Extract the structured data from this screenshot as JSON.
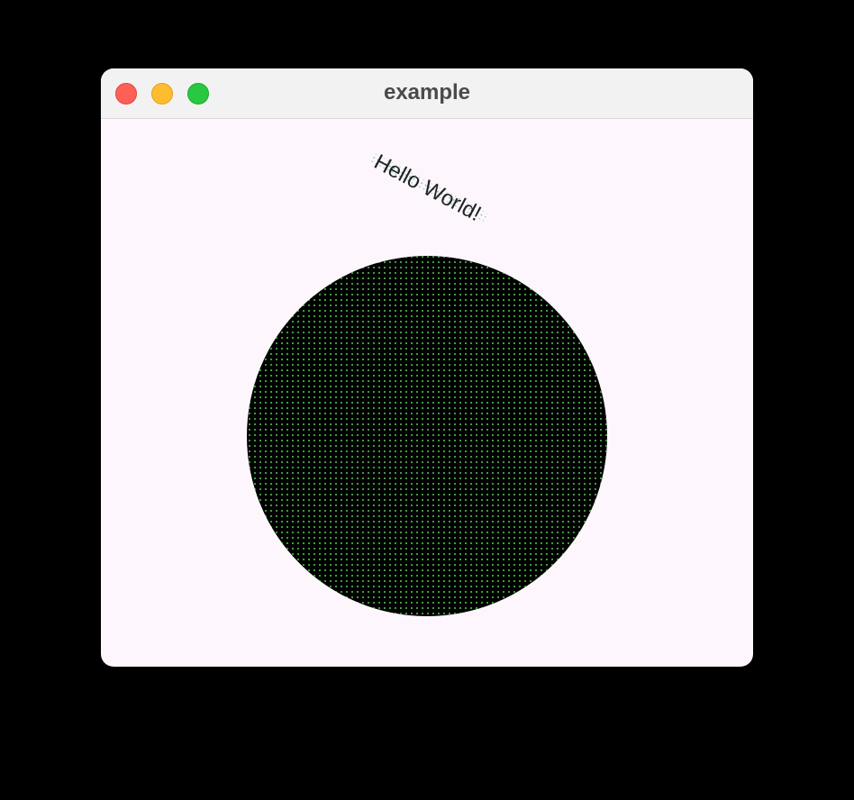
{
  "window": {
    "title": "example"
  },
  "canvas": {
    "greeting_text": "Hello World!",
    "circle_fill": "#000000",
    "dot_pattern_color": "#3f9a3f",
    "text_highlight_color": "#6fc8b4",
    "text_color": "#222222",
    "background": "#fdf7fd"
  },
  "titlebar_buttons": {
    "close_color": "#fe5f57",
    "minimize_color": "#febc2e",
    "zoom_color": "#28c840"
  }
}
